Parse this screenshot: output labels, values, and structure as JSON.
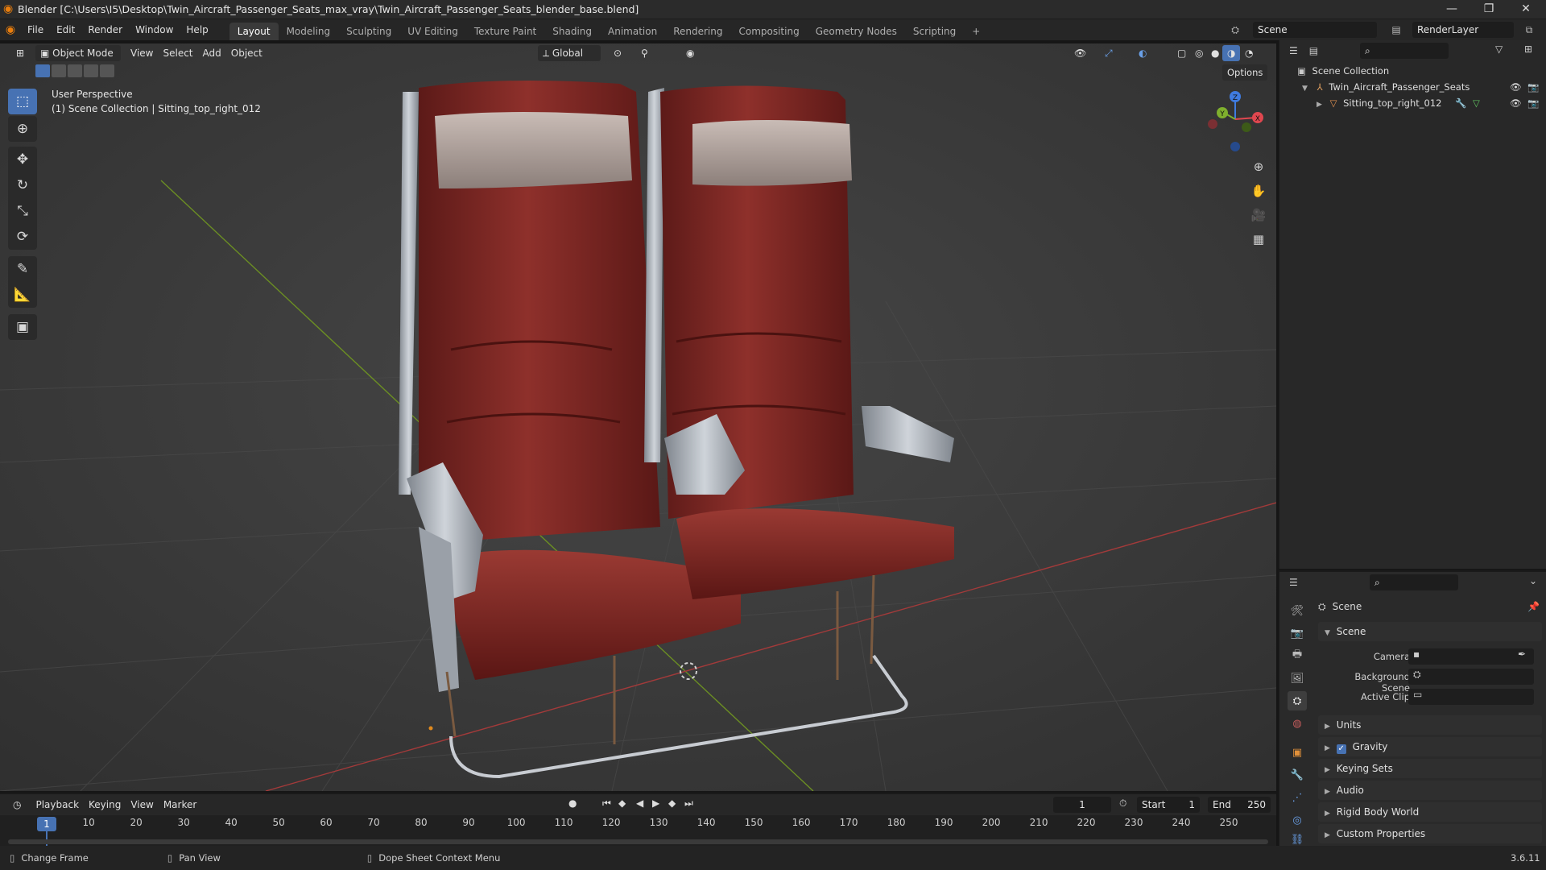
{
  "titlebar": {
    "title": "Blender [C:\\Users\\I5\\Desktop\\Twin_Aircraft_Passenger_Seats_max_vray\\Twin_Aircraft_Passenger_Seats_blender_base.blend]",
    "app_icon": "blender-icon",
    "controls": [
      "minimize",
      "maximize",
      "close"
    ]
  },
  "menubar": {
    "menus": [
      "File",
      "Edit",
      "Render",
      "Window",
      "Help"
    ],
    "workspace_tabs": [
      "Layout",
      "Modeling",
      "Sculpting",
      "UV Editing",
      "Texture Paint",
      "Shading",
      "Animation",
      "Rendering",
      "Compositing",
      "Geometry Nodes",
      "Scripting"
    ],
    "active_tab": "Layout",
    "add_tab": "+",
    "scene_label": "Scene",
    "render_layer_label": "RenderLayer"
  },
  "viewport": {
    "mode": "Object Mode",
    "menus": [
      "View",
      "Select",
      "Add",
      "Object"
    ],
    "orientation": "Global",
    "options_label": "Options",
    "perspective_label": "User Perspective",
    "collection_label": "(1) Scene Collection | Sitting_top_right_012",
    "gizmo_axes": [
      "X",
      "Y",
      "Z"
    ],
    "tools": [
      "select-box",
      "cursor",
      "move",
      "rotate",
      "scale",
      "transform",
      "annotate",
      "measure",
      "add-cube"
    ],
    "accent": "#4772b3",
    "seat_color": "#7a2320",
    "frame_color": "#a7adb5"
  },
  "outliner": {
    "root": "Scene Collection",
    "items": [
      {
        "label": "Twin_Aircraft_Passenger_Seats",
        "type": "collection"
      },
      {
        "label": "Sitting_top_right_012",
        "type": "mesh"
      }
    ]
  },
  "properties": {
    "breadcrumb": "Scene",
    "panel_title": "Scene",
    "fields": [
      {
        "label": "Camera",
        "value": ""
      },
      {
        "label": "Background Scene",
        "value": ""
      },
      {
        "label": "Active Clip",
        "value": ""
      }
    ],
    "collapsed_panels": [
      "Units",
      "Gravity",
      "Keying Sets",
      "Audio",
      "Rigid Body World",
      "Custom Properties"
    ],
    "gravity_checked": true
  },
  "timeline": {
    "menus": [
      "Playback",
      "Keying",
      "View",
      "Marker"
    ],
    "current_frame": "1",
    "start_label": "Start",
    "start_value": "1",
    "end_label": "End",
    "end_value": "250",
    "ticks": [
      "1",
      "10",
      "20",
      "30",
      "40",
      "50",
      "60",
      "70",
      "80",
      "90",
      "100",
      "110",
      "120",
      "130",
      "140",
      "150",
      "160",
      "170",
      "180",
      "190",
      "200",
      "210",
      "220",
      "230",
      "240",
      "250"
    ]
  },
  "statusbar": {
    "hints": [
      "Change Frame",
      "Pan View",
      "Dope Sheet Context Menu"
    ],
    "version": "3.6.11"
  }
}
